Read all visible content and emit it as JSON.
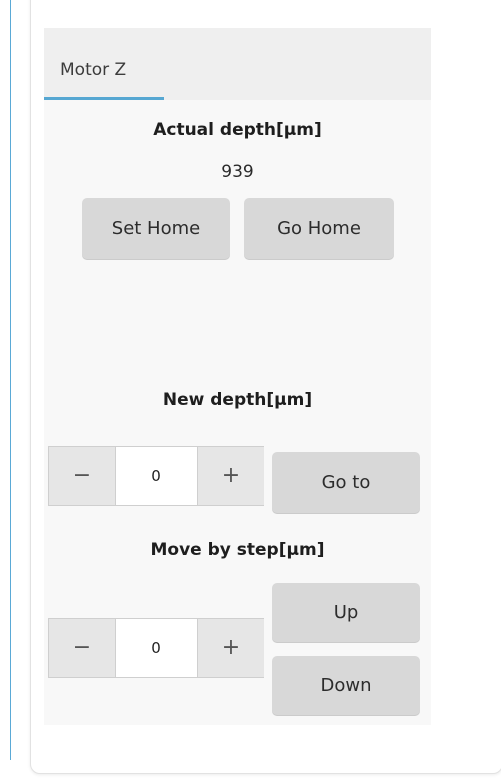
{
  "tabs": [
    {
      "label": "Motor Z",
      "active": true
    }
  ],
  "actual_depth": {
    "heading": "Actual depth[µm]",
    "value": "939",
    "set_home_label": "Set Home",
    "go_home_label": "Go Home"
  },
  "new_depth": {
    "heading": "New depth[µm]",
    "minus_glyph": "−",
    "plus_glyph": "+",
    "value": "0",
    "go_to_label": "Go to"
  },
  "move_by_step": {
    "heading": "Move by step[µm]",
    "minus_glyph": "−",
    "plus_glyph": "+",
    "value": "0",
    "up_label": "Up",
    "down_label": "Down"
  },
  "colors": {
    "accent": "#56a7d2",
    "button_bg": "#d8d8d8",
    "card_bg": "#f8f8f8"
  }
}
